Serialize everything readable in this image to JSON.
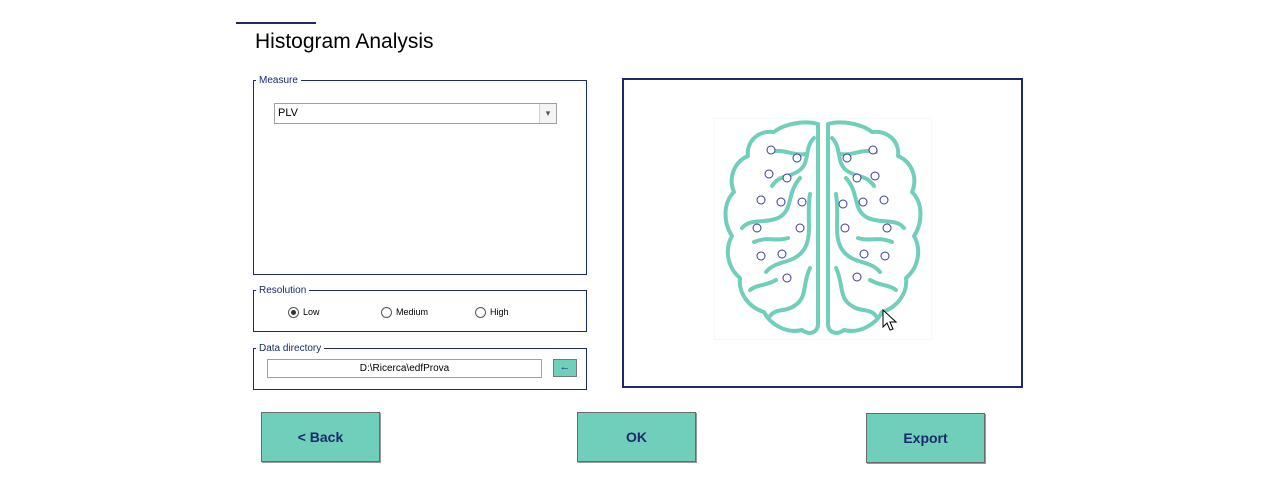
{
  "page": {
    "title": "Histogram Analysis"
  },
  "measure": {
    "legend": "Measure",
    "selected": "PLV"
  },
  "resolution": {
    "legend": "Resolution",
    "options": [
      {
        "label": "Low",
        "selected": true
      },
      {
        "label": "Medium",
        "selected": false
      },
      {
        "label": "High",
        "selected": false
      }
    ]
  },
  "data_directory": {
    "legend": "Data directory",
    "value": "D:\\Ricerca\\edfProva",
    "browse_label": "←"
  },
  "buttons": {
    "back": "<  Back",
    "ok": "OK",
    "export": "Export"
  },
  "colors": {
    "accent": "#6fcfba",
    "border": "#1a2a6c",
    "brain": "#6fcfba",
    "electrode": "#3a3aa0"
  },
  "icons": {
    "select_arrow": "chevron-down-icon",
    "browse": "arrow-left-icon"
  }
}
